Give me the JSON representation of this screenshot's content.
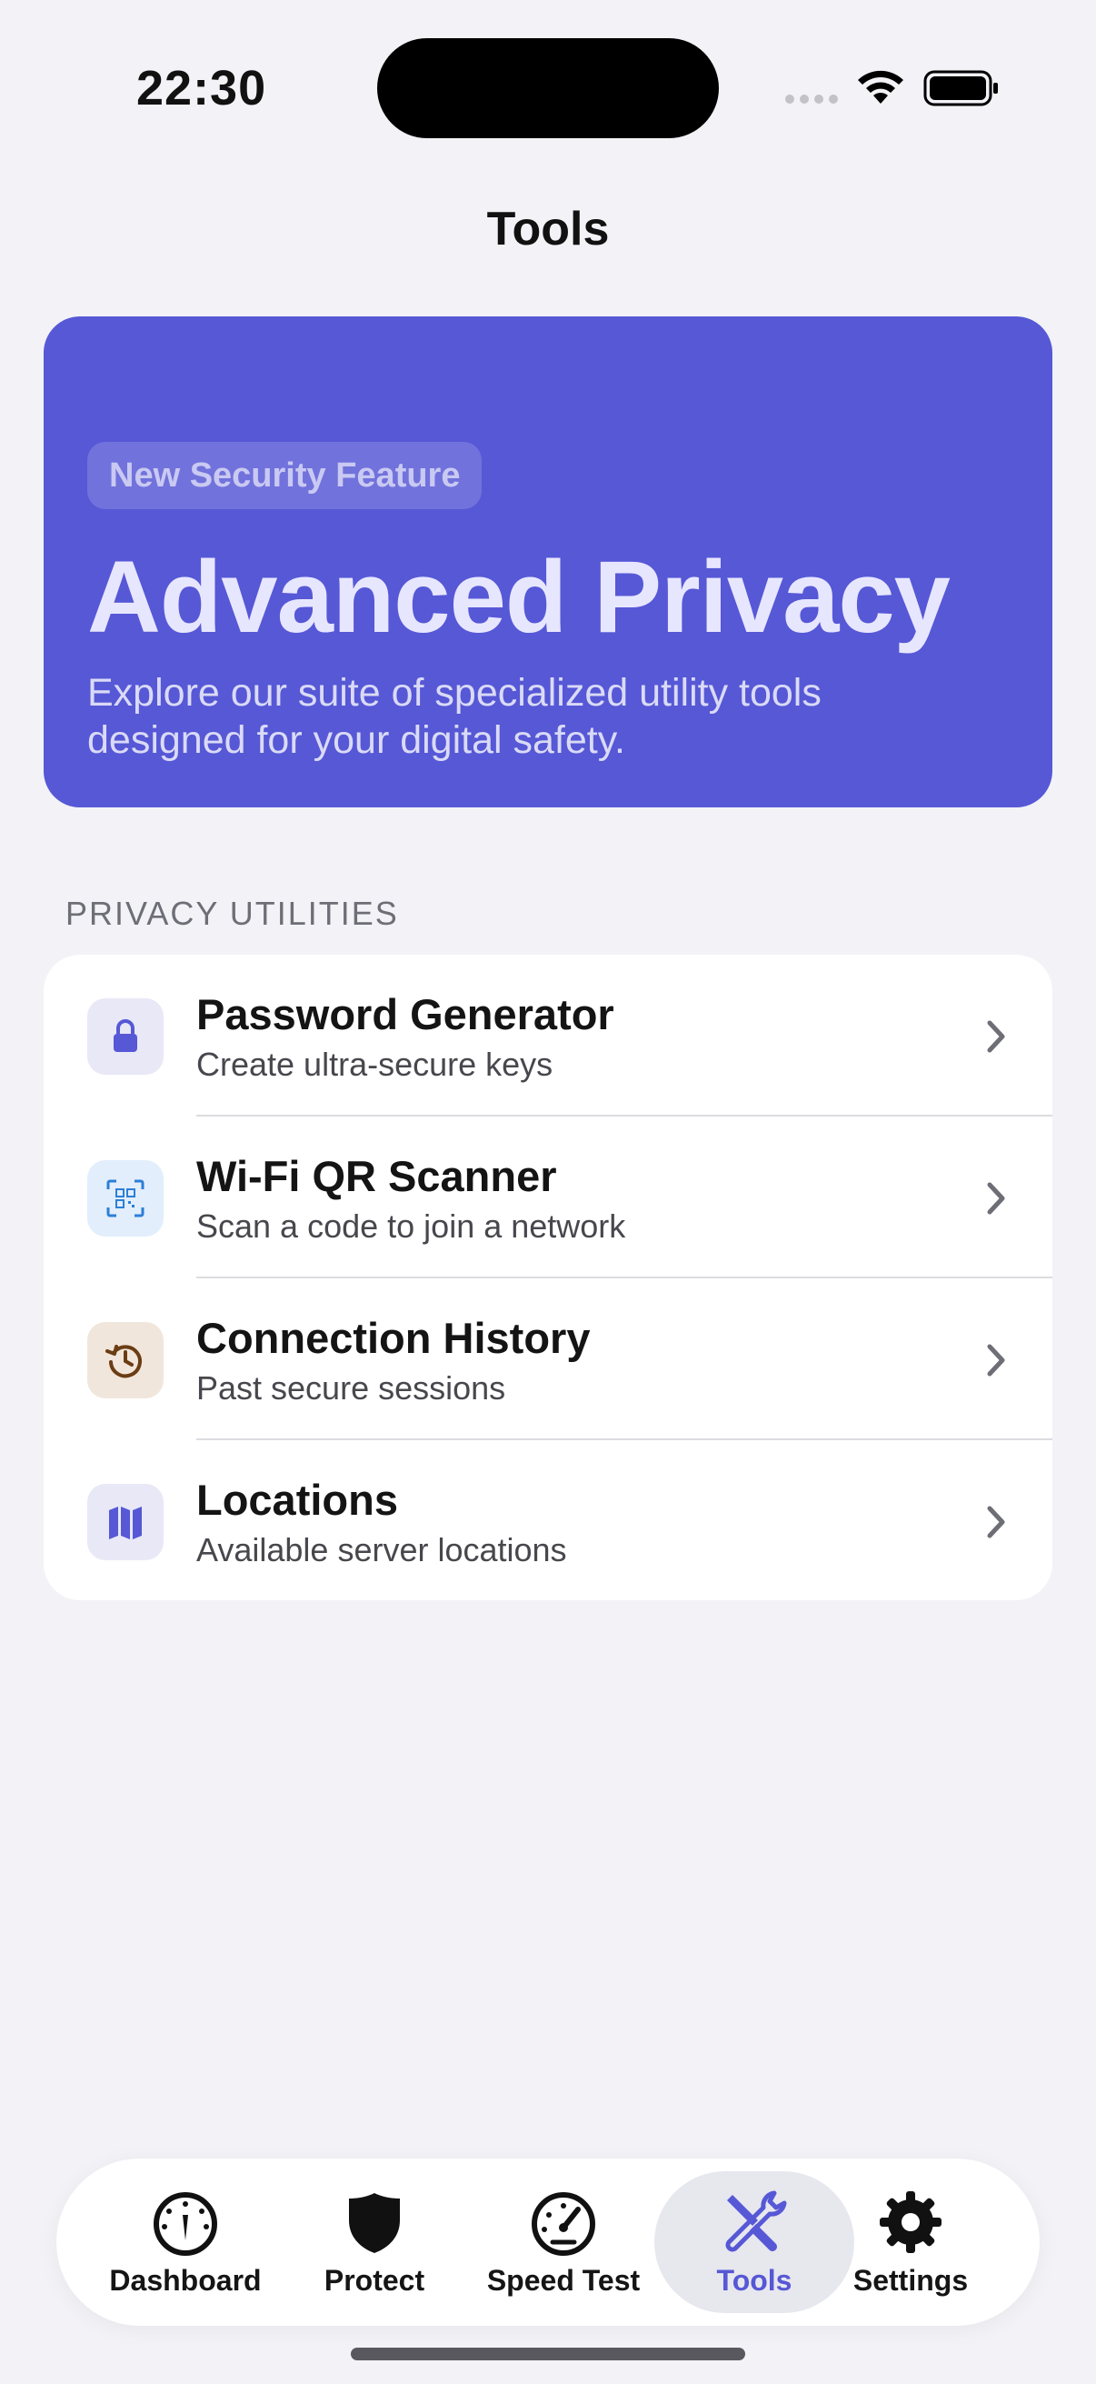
{
  "status_bar": {
    "time": "22:30"
  },
  "page": {
    "title": "Tools"
  },
  "hero": {
    "badge": "New Security Feature",
    "title": "Advanced Privacy",
    "description": "Explore our suite of specialized utility tools designed for your digital safety."
  },
  "privacy_utilities": {
    "header": "PRIVACY UTILITIES",
    "items": [
      {
        "title": "Password Generator",
        "subtitle": "Create ultra-secure keys",
        "icon": "lock-icon"
      },
      {
        "title": "Wi-Fi QR Scanner",
        "subtitle": "Scan a code to join a network",
        "icon": "qr-scan-icon"
      },
      {
        "title": "Connection History",
        "subtitle": "Past secure sessions",
        "icon": "history-icon"
      },
      {
        "title": "Locations",
        "subtitle": "Available server locations",
        "icon": "map-icon"
      }
    ]
  },
  "tab_bar": {
    "tabs": [
      {
        "label": "Dashboard",
        "icon": "gauge-icon"
      },
      {
        "label": "Protect",
        "icon": "shield-icon"
      },
      {
        "label": "Speed Test",
        "icon": "speedometer-icon"
      },
      {
        "label": "Tools",
        "icon": "tools-icon",
        "active": true
      },
      {
        "label": "Settings",
        "icon": "gear-icon"
      }
    ]
  },
  "colors": {
    "accent": "#5658d6",
    "background": "#f2f2f7"
  }
}
